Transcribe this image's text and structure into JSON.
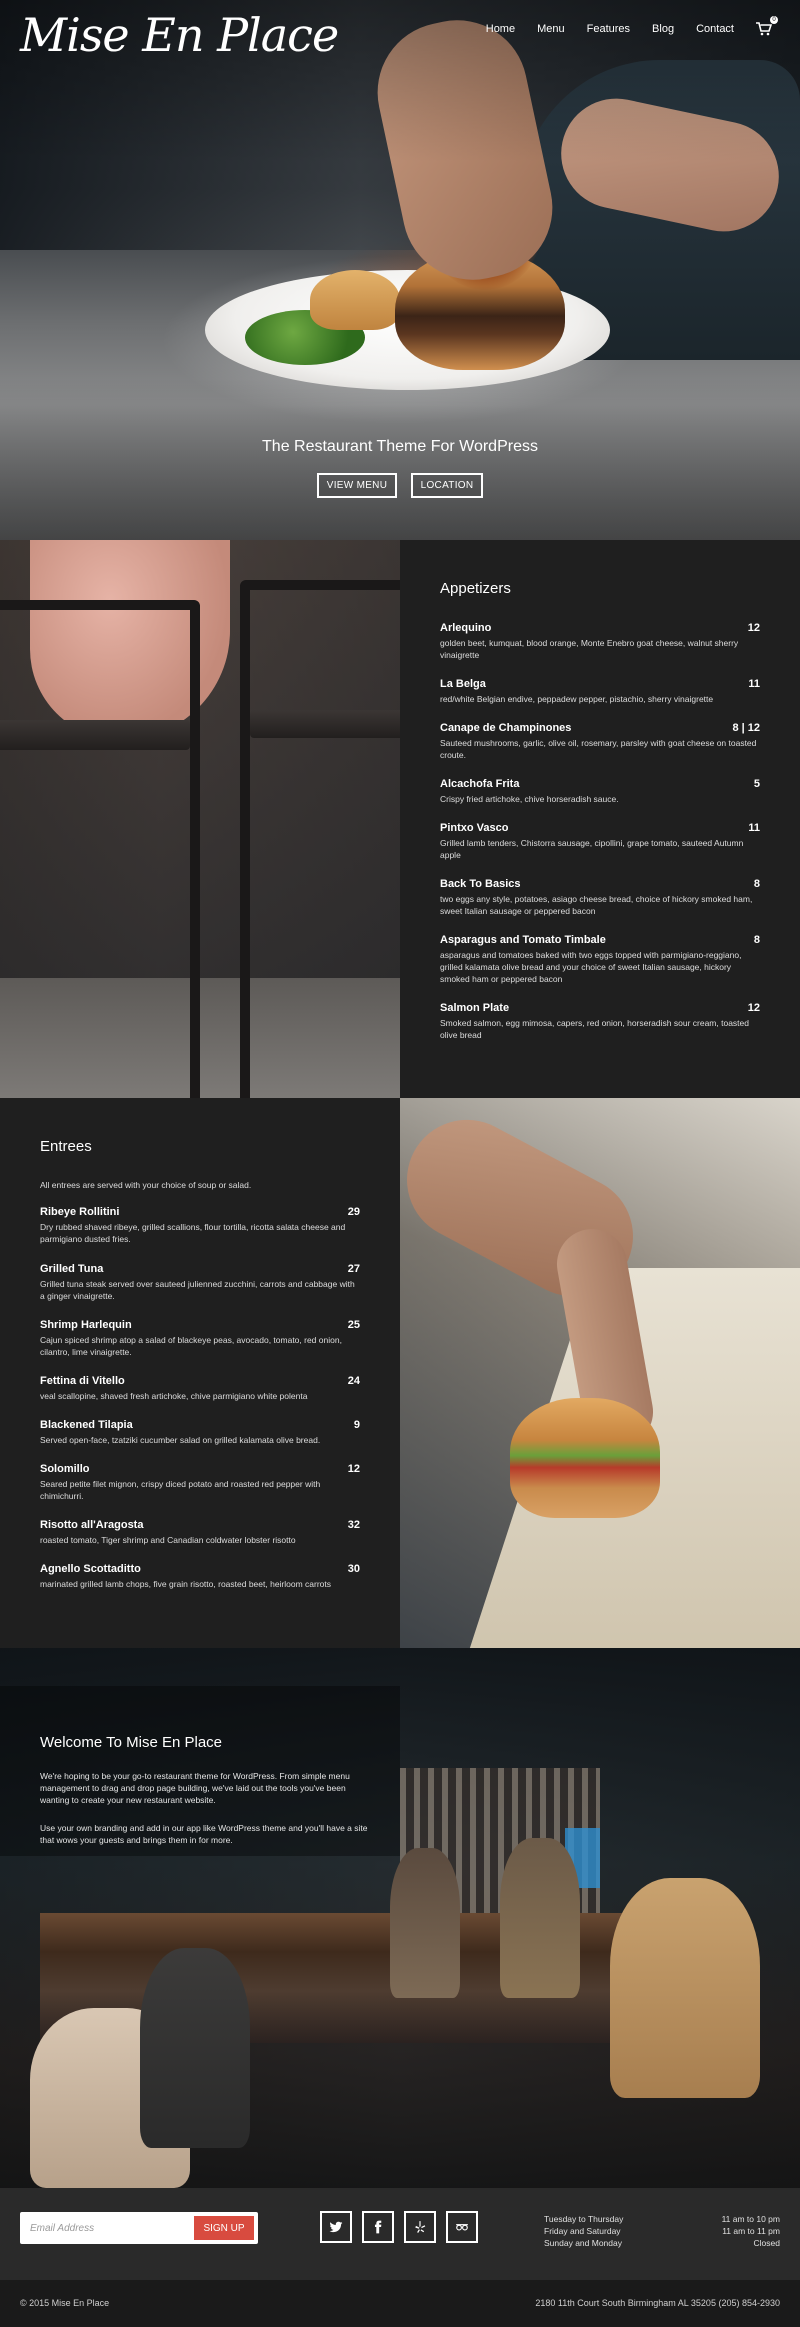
{
  "site": {
    "logo": "Mise En Place"
  },
  "nav": {
    "items": [
      "Home",
      "Menu",
      "Features",
      "Blog",
      "Contact"
    ],
    "cart_count": "0"
  },
  "hero": {
    "tagline": "The Restaurant Theme For WordPress",
    "buttons": [
      "VIEW MENU",
      "LOCATION"
    ]
  },
  "appetizers": {
    "title": "Appetizers",
    "items": [
      {
        "name": "Arlequino",
        "price": "12",
        "desc": "golden beet, kumquat, blood orange, Monte Enebro goat cheese, walnut sherry vinaigrette"
      },
      {
        "name": "La Belga",
        "price": "11",
        "desc": "red/white Belgian endive, peppadew pepper, pistachio, sherry vinaigrette"
      },
      {
        "name": "Canape de Champinones",
        "price": "8 | 12",
        "desc": "Sauteed mushrooms, garlic, olive oil, rosemary, parsley with goat cheese on toasted croute."
      },
      {
        "name": "Alcachofa Frita",
        "price": "5",
        "desc": "Crispy fried artichoke, chive horseradish sauce."
      },
      {
        "name": "Pintxo Vasco",
        "price": "11",
        "desc": "Grilled lamb tenders, Chistorra sausage, cipollini, grape tomato, sauteed Autumn apple"
      },
      {
        "name": "Back To Basics",
        "price": "8",
        "desc": "two eggs any style, potatoes, asiago cheese bread, choice of hickory smoked ham, sweet Italian sausage or peppered bacon"
      },
      {
        "name": "Asparagus and Tomato Timbale",
        "price": "8",
        "desc": "asparagus and tomatoes baked with two eggs topped with parmigiano-reggiano, grilled kalamata olive bread and your choice of sweet Italian sausage, hickory smoked ham or peppered bacon"
      },
      {
        "name": "Salmon Plate",
        "price": "12",
        "desc": "Smoked salmon, egg mimosa, capers, red onion, horseradish sour cream, toasted olive bread"
      }
    ]
  },
  "entrees": {
    "title": "Entrees",
    "intro": "All entrees are served with your choice of soup or salad.",
    "items": [
      {
        "name": "Ribeye Rollitini",
        "price": "29",
        "desc": "Dry rubbed shaved ribeye, grilled scallions, flour tortilla, ricotta salata cheese and parmigiano dusted fries."
      },
      {
        "name": "Grilled Tuna",
        "price": "27",
        "desc": "Grilled tuna steak served over sauteed julienned zucchini, carrots and cabbage with a ginger vinaigrette."
      },
      {
        "name": "Shrimp Harlequin",
        "price": "25",
        "desc": "Cajun spiced shrimp atop a salad of blackeye peas, avocado, tomato, red onion, cilantro, lime vinaigrette."
      },
      {
        "name": "Fettina di Vitello",
        "price": "24",
        "desc": "veal scallopine, shaved fresh artichoke, chive parmigiano white polenta"
      },
      {
        "name": "Blackened Tilapia",
        "price": "9",
        "desc": "Served open-face, tzatziki cucumber salad on grilled kalamata olive bread."
      },
      {
        "name": "Solomillo",
        "price": "12",
        "desc": "Seared petite filet mignon, crispy diced potato and roasted red pepper with chimichurri."
      },
      {
        "name": "Risotto all'Aragosta",
        "price": "32",
        "desc": "roasted tomato, Tiger shrimp and Canadian coldwater lobster risotto"
      },
      {
        "name": "Agnello Scottaditto",
        "price": "30",
        "desc": "marinated grilled lamb chops, five grain risotto, roasted beet, heirloom carrots"
      }
    ]
  },
  "welcome": {
    "title": "Welcome To Mise En Place",
    "p1": "We're hoping to be your go-to restaurant theme for WordPress.  From simple menu management to drag and drop page building, we've laid out the tools you've been wanting to create your new restaurant website.",
    "p2": "Use your own branding and add in our app like WordPress theme and you'll have a site that wows your guests and brings them in for more."
  },
  "footer": {
    "email_placeholder": "Email Address",
    "signup_label": "SIGN UP",
    "socials": [
      "twitter-icon",
      "facebook-icon",
      "yelp-icon",
      "tripadvisor-icon"
    ],
    "hours": [
      {
        "days": "Tuesday to Thursday",
        "time": "11 am to 10 pm"
      },
      {
        "days": "Friday and Saturday",
        "time": "11 am to 11 pm"
      },
      {
        "days": "Sunday and Monday",
        "time": "Closed"
      }
    ],
    "copyright": "© 2015 Mise En Place",
    "address": "2180 11th Court South Birmingham AL 35205   (205) 854-2930"
  },
  "colors": {
    "accent": "#d84b3f",
    "dark_panel": "#1f1f1f",
    "footer": "#2a2a2a"
  }
}
